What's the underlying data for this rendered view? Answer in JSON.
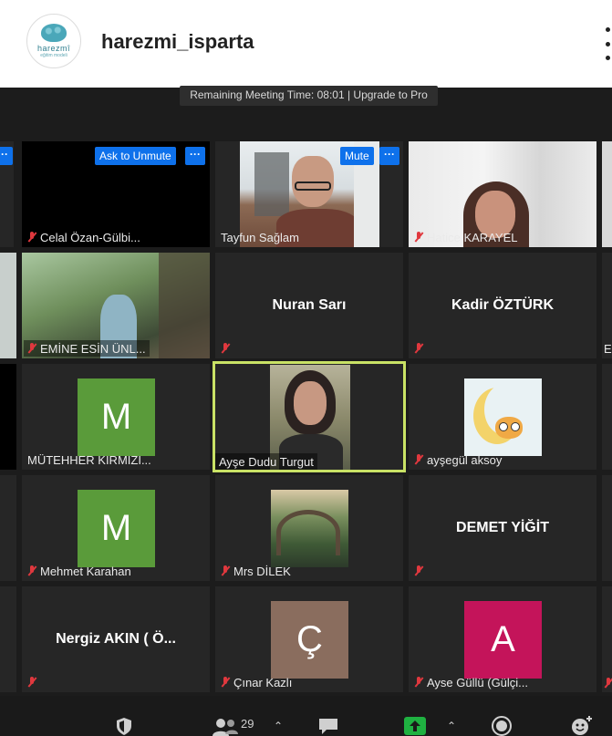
{
  "header": {
    "username": "harezmi_isparta",
    "logo_text": "harezmî",
    "logo_sub": "eğitim modeli"
  },
  "banner": {
    "text": "Remaining Meeting Time: 08:01 | Upgrade to Pro"
  },
  "tiles": {
    "celal": {
      "name": "Celal Özan-Gülbi...",
      "ask_unmute": "Ask to Unmute"
    },
    "tayfun": {
      "name": "Tayfun Sağlam",
      "mute": "Mute"
    },
    "hatice": {
      "name": "Hatice KARAYEL"
    },
    "emine": {
      "name": "EMİNE ESİN ÜNL..."
    },
    "nuran": {
      "name": "Nuran Sarı"
    },
    "kadir": {
      "name": "Kadir ÖZTÜRK"
    },
    "mutehher": {
      "name": "MÜTEHHER KIRMIZI...",
      "initial": "M"
    },
    "ayse_dudu": {
      "name": "Ayşe Dudu Turgut"
    },
    "aysegul": {
      "name": "ayşegül aksoy"
    },
    "mehmet": {
      "name": "Mehmet Karahan",
      "initial": "M"
    },
    "mrs_dilek": {
      "name": "Mrs DİLEK"
    },
    "demet": {
      "name": "DEMET YİĞİT"
    },
    "nergiz": {
      "name": "Nergiz AKIN ( Ö..."
    },
    "cinar": {
      "name": "Çınar Kazlı",
      "initial": "Ç"
    },
    "ayse_gullu": {
      "name": "Ayse Güllü (Gülçi...",
      "initial": "A"
    },
    "edge_e": {
      "name": "E"
    }
  },
  "toolbar": {
    "participants_count": "29"
  },
  "colors": {
    "accent_blue": "#0e71eb",
    "active_border": "#c9e265",
    "avatar_green": "#5a9b3a",
    "avatar_magenta": "#c4145a",
    "avatar_brown": "#8a6d5e",
    "mute_red": "#e0383e"
  }
}
